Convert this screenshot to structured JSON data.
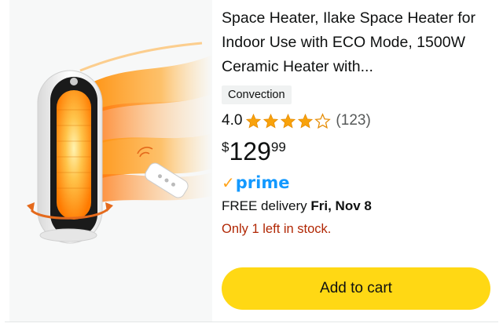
{
  "product": {
    "title": "Space Heater, Ilake Space Heater for Indoor Use with ECO Mode, 1500W Ceramic Heater with...",
    "badge": "Convection",
    "rating": "4.0",
    "rating_value": 4.0,
    "rating_max": 5,
    "review_count": "(123)",
    "price_symbol": "$",
    "price_whole": "129",
    "price_fraction": "99",
    "prime_label": "prime",
    "delivery_prefix": "FREE delivery",
    "delivery_date": "Fri, Nov 8",
    "stock": "Only 1 left in stock.",
    "add_to_cart": "Add to cart"
  },
  "colors": {
    "star": "#f8a20c",
    "price_text": "#0f1111",
    "stock": "#b12704",
    "cart_button": "#ffd814",
    "prime_blue": "#1399ff",
    "prime_check": "#ffa41c"
  },
  "icons": {
    "star_full": "star-filled-icon",
    "star_empty": "star-outline-icon",
    "prime_check": "prime-check-icon"
  }
}
